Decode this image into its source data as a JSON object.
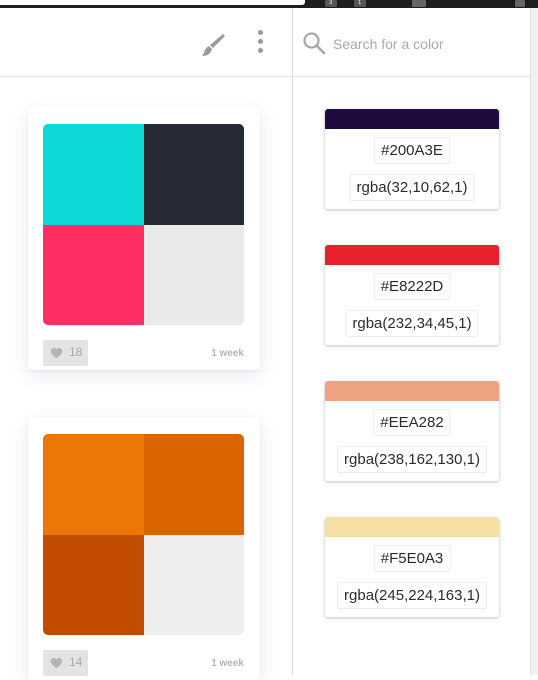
{
  "browser_strip": {
    "ext_badges": [
      "3",
      "1"
    ]
  },
  "header": {
    "brush_icon": "paint-brush-icon",
    "menu_icon": "more-vertical-icon"
  },
  "search": {
    "placeholder": "Search for a color",
    "value": "",
    "icon": "search-icon"
  },
  "palettes": [
    {
      "colors": [
        "#0AD9D6",
        "#252A34",
        "#FF2E63",
        "#EAEAEA"
      ],
      "likes": "18",
      "time": "1 week"
    },
    {
      "colors": [
        "#EC7704",
        "#DB6400",
        "#C24D00",
        "#EEEEEE"
      ],
      "likes": "14",
      "time": "1 week"
    }
  ],
  "colors": [
    {
      "hex": "#200A3E",
      "rgba": "rgba(32,10,62,1)"
    },
    {
      "hex": "#E8222D",
      "rgba": "rgba(232,34,45,1)"
    },
    {
      "hex": "#EEA282",
      "rgba": "rgba(238,162,130,1)"
    },
    {
      "hex": "#F5E0A3",
      "rgba": "rgba(245,224,163,1)"
    }
  ]
}
